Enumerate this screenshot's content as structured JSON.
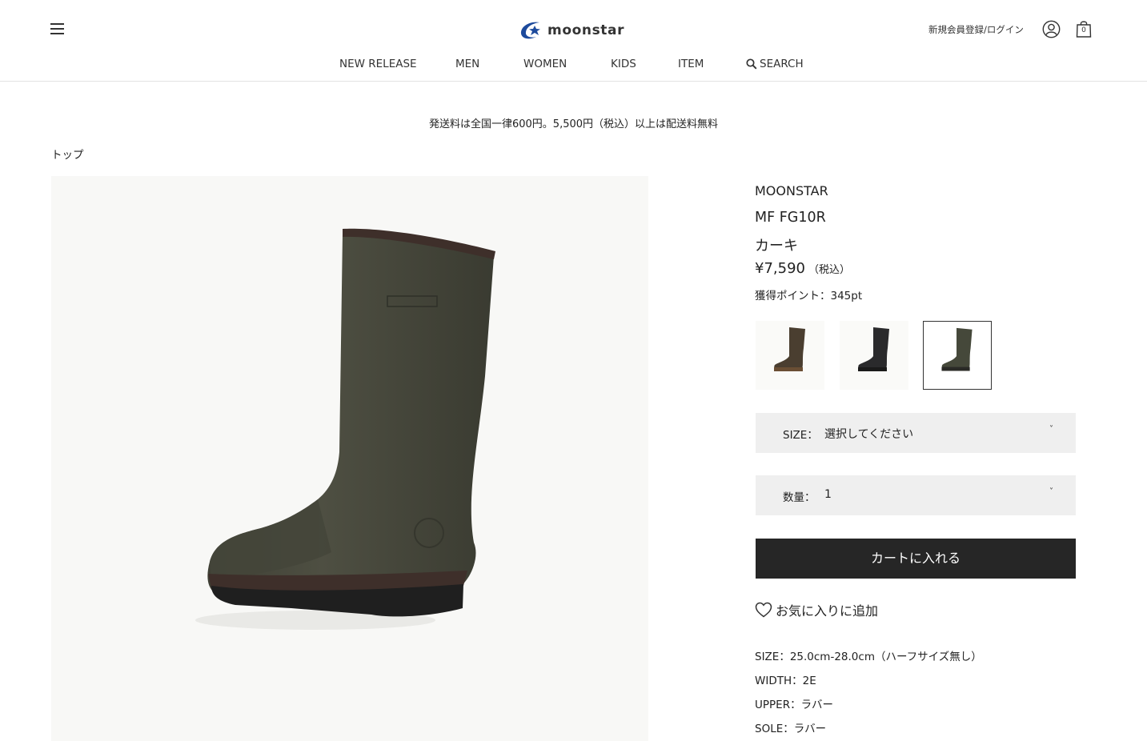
{
  "header": {
    "logo_text": "moonstar",
    "login_label": "新規会員登録/ログイン",
    "cart_count": "0"
  },
  "nav": {
    "items": [
      "NEW RELEASE",
      "MEN",
      "WOMEN",
      "KIDS",
      "ITEM"
    ],
    "search_label": "SEARCH"
  },
  "notice": "発送料は全国一律600円。5,500円（税込）以上は配送料無料",
  "breadcrumb": "トップ",
  "product": {
    "brand": "MOONSTAR",
    "model": "MF FG10R",
    "color_name": "カーキ",
    "price": "¥7,590",
    "price_tax": "（税込）",
    "points": "獲得ポイント：345pt",
    "variants": [
      {
        "name": "brown",
        "color": "#4a3e30",
        "sole": "#6a4e34",
        "selected": false
      },
      {
        "name": "black",
        "color": "#2a2a2c",
        "sole": "#1a1a1a",
        "selected": false
      },
      {
        "name": "khaki",
        "color": "#45483a",
        "sole": "#2a2a26",
        "selected": true
      }
    ],
    "size_label": "SIZE：",
    "size_value": "選択してください",
    "qty_label": "数量：",
    "qty_value": "1",
    "cart_button": "カートに入れる",
    "favorite_label": "お気に入りに追加",
    "specs": [
      "SIZE：25.0cm-28.0cm（ハーフサイズ無し）",
      "WIDTH：2E",
      "UPPER：ラバー",
      "SOLE：ラバー"
    ]
  },
  "colors": {
    "boot_body": "#4b4c3f",
    "boot_shadow": "#3a3b31",
    "boot_sole": "#1f1f1f",
    "boot_rim": "#3e2f2a",
    "button_bg": "#262626",
    "select_bg": "#efefef"
  }
}
